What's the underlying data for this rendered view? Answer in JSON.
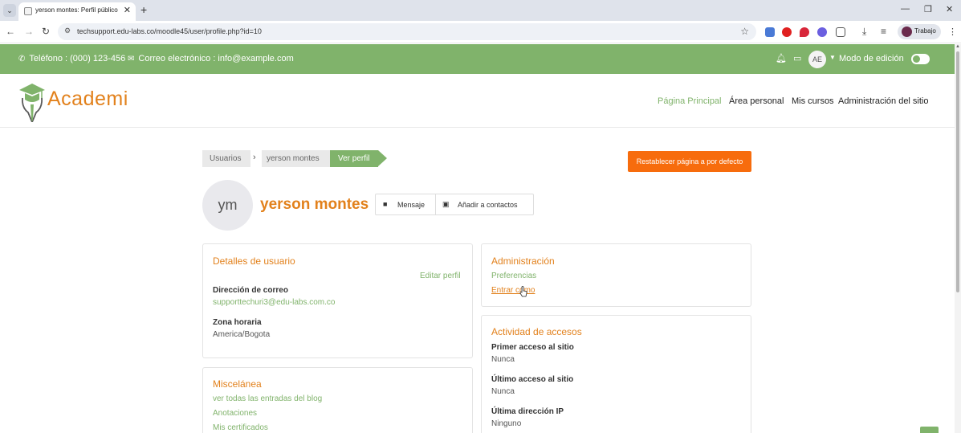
{
  "browser": {
    "tab_title": "yerson montes: Perfil público | T",
    "url": "techsupport.edu-labs.co/moodle45/user/profile.php?id=10",
    "profile_label": "Trabajo"
  },
  "topbar": {
    "phone": "Teléfono : (000) 123-456",
    "email": "Correo electrónico : info@example.com",
    "avatar_initials": "AE",
    "edit_mode_label": "Modo de edición"
  },
  "header": {
    "logo_text": "Academi",
    "nav": [
      "Página Principal",
      "Área personal",
      "Mis cursos",
      "Administración del sitio"
    ]
  },
  "breadcrumb": [
    "Usuarios",
    "yerson montes",
    "Ver perfil"
  ],
  "reset_button": "Restablecer página a por defecto",
  "profile": {
    "initials": "ym",
    "name": "yerson montes",
    "message_label": "Mensaje",
    "add_contact_label": "Añadir a contactos"
  },
  "user_details": {
    "title": "Detalles de usuario",
    "edit_link": "Editar perfil",
    "email_label": "Dirección de correo",
    "email_value": "supporttechuri3@edu-labs.com.co",
    "timezone_label": "Zona horaria",
    "timezone_value": "America/Bogota"
  },
  "administration": {
    "title": "Administración",
    "links": [
      "Preferencias",
      "Entrar como"
    ]
  },
  "access_activity": {
    "title": "Actividad de accesos",
    "first_access_label": "Primer acceso al sitio",
    "first_access_value": "Nunca",
    "last_access_label": "Último acceso al sitio",
    "last_access_value": "Nunca",
    "last_ip_label": "Última dirección IP",
    "last_ip_value": "Ninguno"
  },
  "misc": {
    "title": "Miscelánea",
    "links": [
      "ver todas las entradas del blog",
      "Anotaciones",
      "Mis certificados"
    ]
  },
  "colors": {
    "brand_green": "#80b36b",
    "brand_orange": "#e2811c",
    "button_orange": "#f76c0d"
  }
}
